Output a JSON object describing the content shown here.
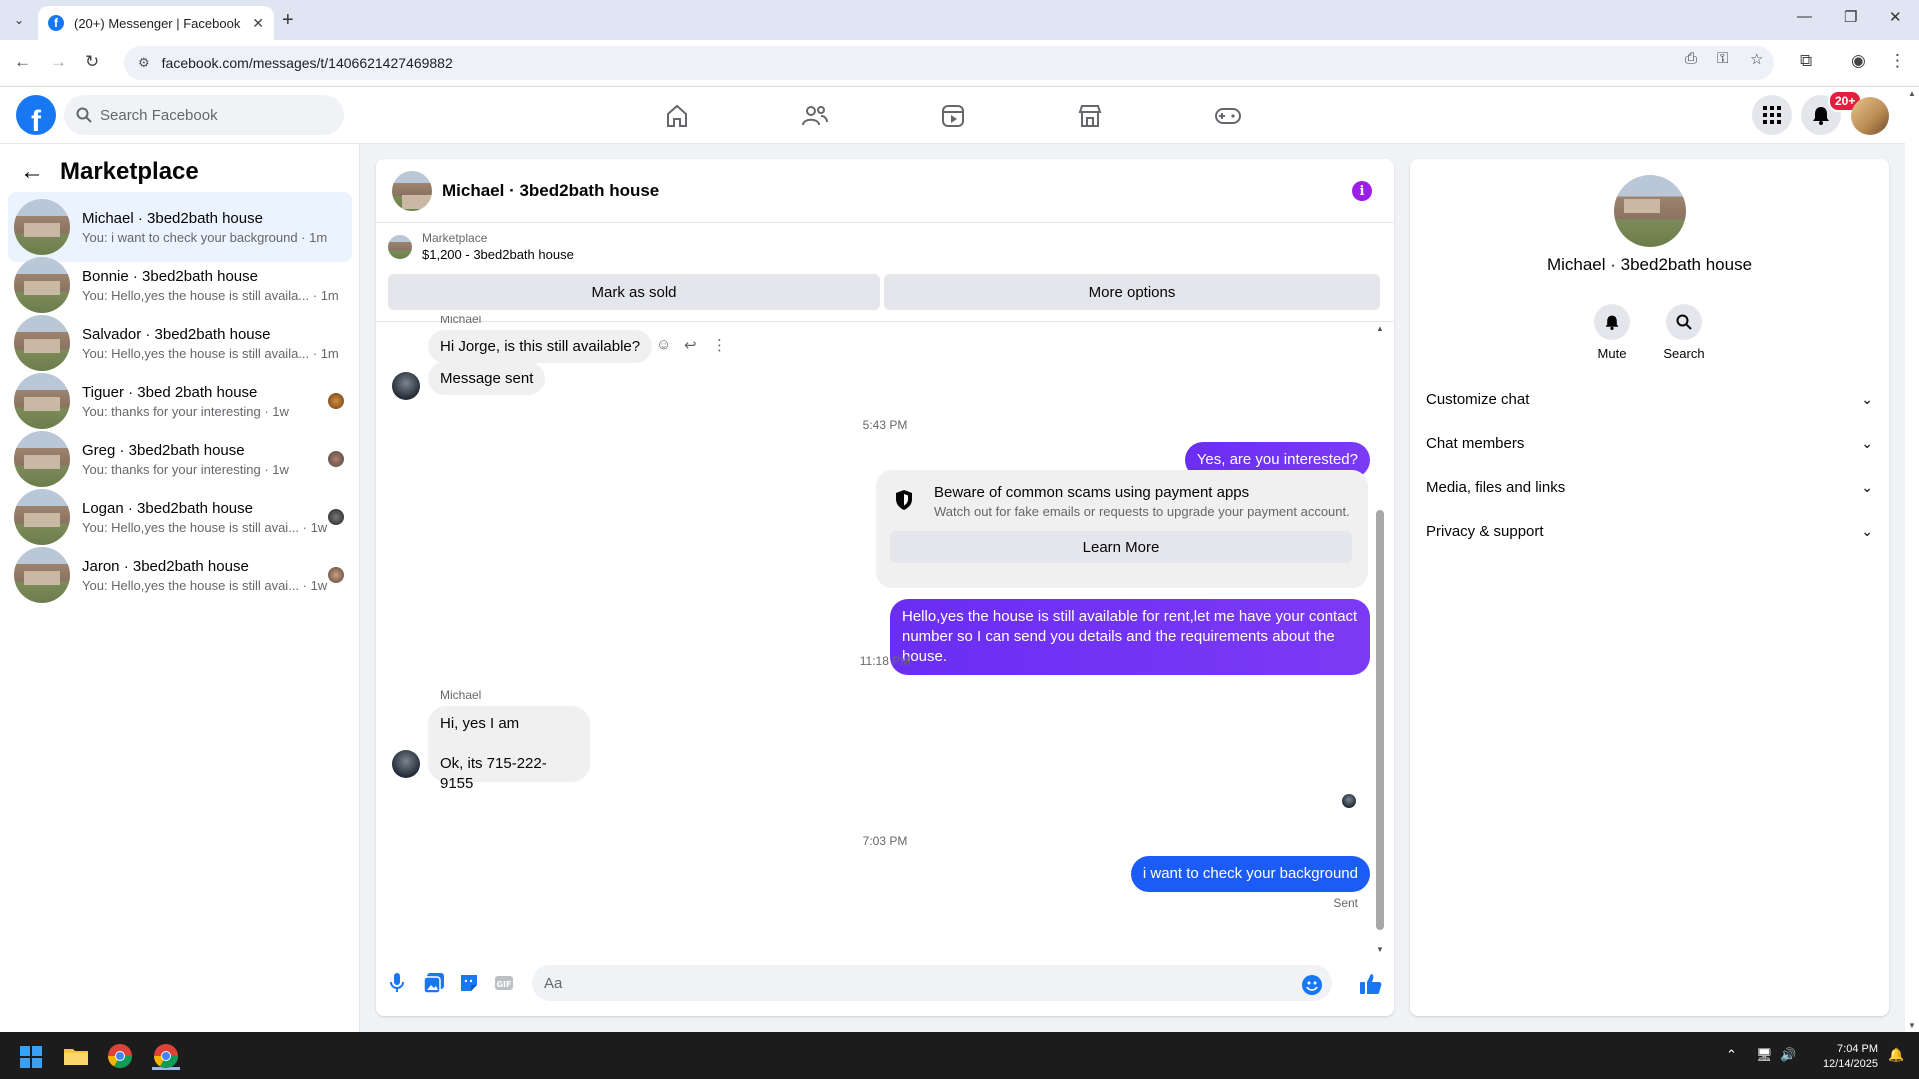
{
  "browser": {
    "tab_title": "(20+) Messenger | Facebook",
    "url": "facebook.com/messages/t/1406621427469882"
  },
  "fb": {
    "search_placeholder": "Search Facebook",
    "notification_badge": "20+"
  },
  "sidebar": {
    "title": "Marketplace",
    "conversations": [
      {
        "name": "Michael · 3bed2bath house",
        "preview": "You: i want to check your background · 1m"
      },
      {
        "name": "Bonnie · 3bed2bath house",
        "preview": "You: Hello,yes the house is still availa... · 1m"
      },
      {
        "name": "Salvador · 3bed2bath house",
        "preview": "You: Hello,yes the house is still availa... · 1m"
      },
      {
        "name": "Tiguer · 3bed 2bath house",
        "preview": "You: thanks for your interesting · 1w"
      },
      {
        "name": "Greg · 3bed2bath house",
        "preview": "You: thanks for your interesting · 1w"
      },
      {
        "name": "Logan · 3bed2bath house",
        "preview": "You: Hello,yes the house is still avai... · 1w"
      },
      {
        "name": "Jaron · 3bed2bath house",
        "preview": "You: Hello,yes the house is still avai... · 1w"
      }
    ]
  },
  "chat": {
    "title": "Michael · 3bed2bath house",
    "marketplace_label": "Marketplace",
    "listing": "$1,200 - 3bed2bath house",
    "mark_sold": "Mark as sold",
    "more_options": "More options",
    "sender_partial": "Michael",
    "msg1": "Hi Jorge, is this still available?",
    "msg2": "Message sent",
    "time1": "5:43 PM",
    "out1": "Yes, are you interested?",
    "scam_title": "Beware of common scams using payment apps",
    "scam_desc": "Watch out for fake emails or requests to upgrade your payment account.",
    "learn_more": "Learn More",
    "out2": "Hello,yes the house is still available for rent,let me have your contact number   so I can send you details and the requirements about the house.",
    "time2": "11:18 PM",
    "sender": "Michael",
    "in3a": "Hi, yes I am",
    "in3b": "Ok, its 715-222-9155",
    "time3": "7:03 PM",
    "out3": "i want to check your  background",
    "status": "Sent",
    "composer_placeholder": "Aa"
  },
  "details": {
    "name": "Michael · 3bed2bath house",
    "mute": "Mute",
    "search": "Search",
    "sections": [
      "Customize chat",
      "Chat members",
      "Media, files and links",
      "Privacy & support"
    ]
  },
  "taskbar": {
    "time": "7:04 PM",
    "date": "12/14/2025"
  },
  "colors": {
    "fb_blue": "#1877f2",
    "outgoing_purple": "#6a2ef3",
    "outgoing_blue": "#1a5cf5",
    "badge_red": "#e41e3f"
  }
}
